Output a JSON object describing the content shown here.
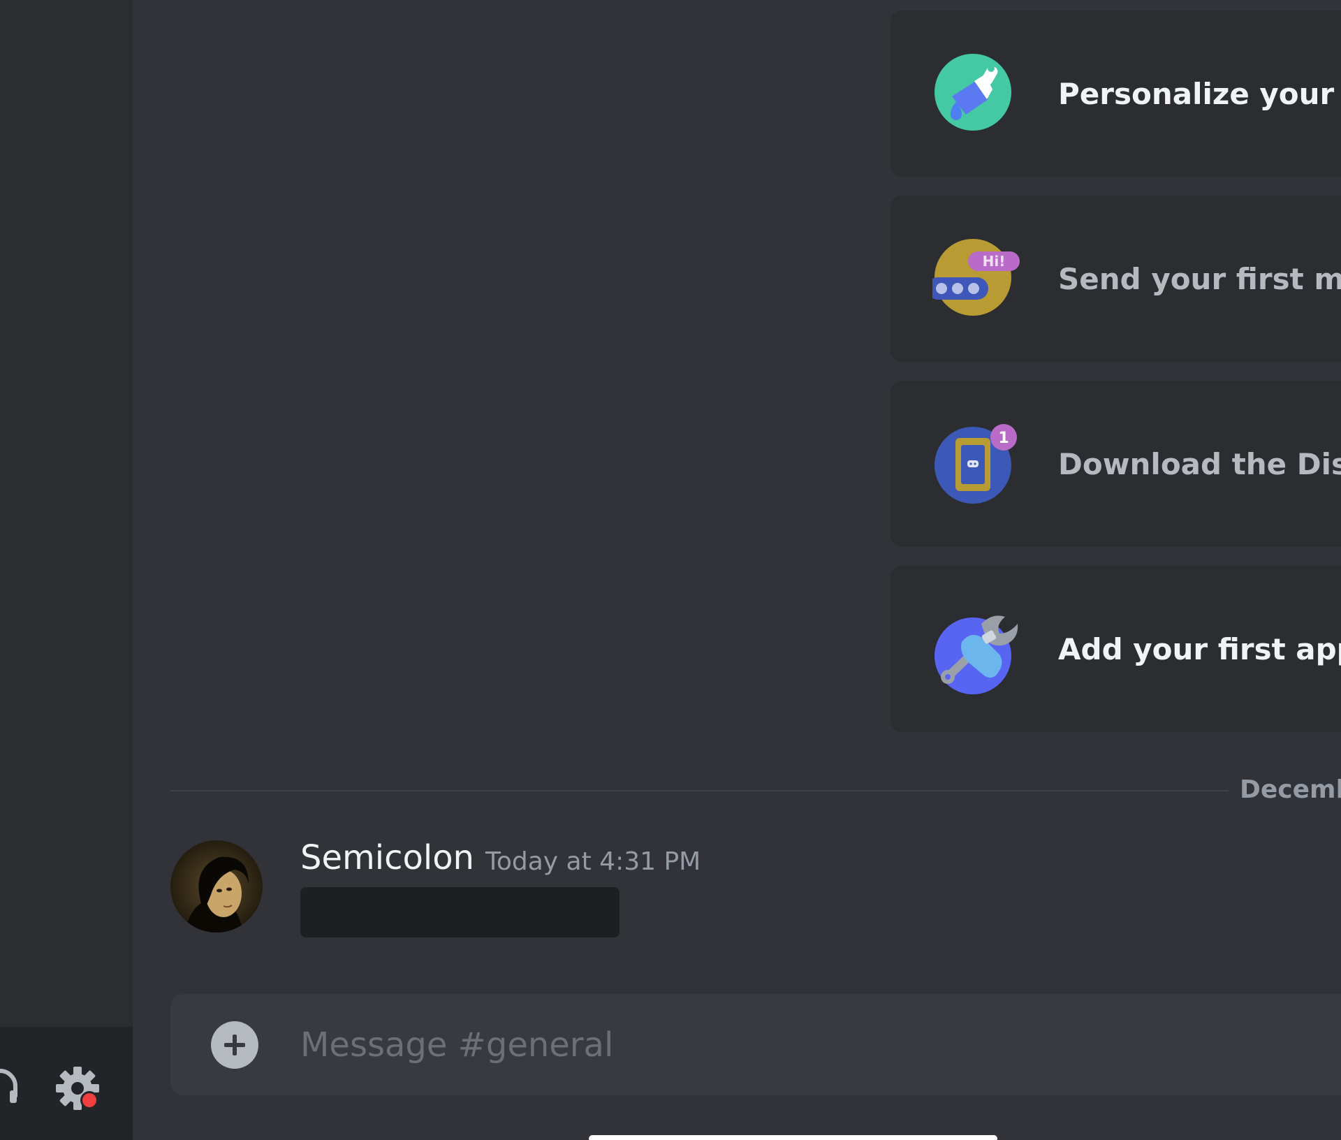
{
  "onboarding": {
    "cards": [
      {
        "label": "Personalize your ser",
        "icon": "paintbrush-icon",
        "state": "active"
      },
      {
        "label": "Send your first mess",
        "icon": "hi-chat-bubble-icon",
        "state": "muted"
      },
      {
        "label": "Download the Disco",
        "icon": "mobile-app-icon",
        "state": "muted",
        "badge": "1"
      },
      {
        "label": "Add your first app",
        "icon": "wrench-hand-icon",
        "state": "active"
      }
    ]
  },
  "chat": {
    "date_divider": "Decemb",
    "message": {
      "author": "Semicolon",
      "timestamp": "Today at 4:31 PM"
    }
  },
  "composer": {
    "placeholder": "Message #general"
  },
  "user_panel": {
    "icons": [
      "headphone-icon",
      "settings-icon"
    ],
    "notification_color": "#f23f42"
  },
  "colors": {
    "background": "#313338",
    "sidebar": "#2b2d31",
    "card": "#2b2d31",
    "accent": "#5865f2"
  }
}
